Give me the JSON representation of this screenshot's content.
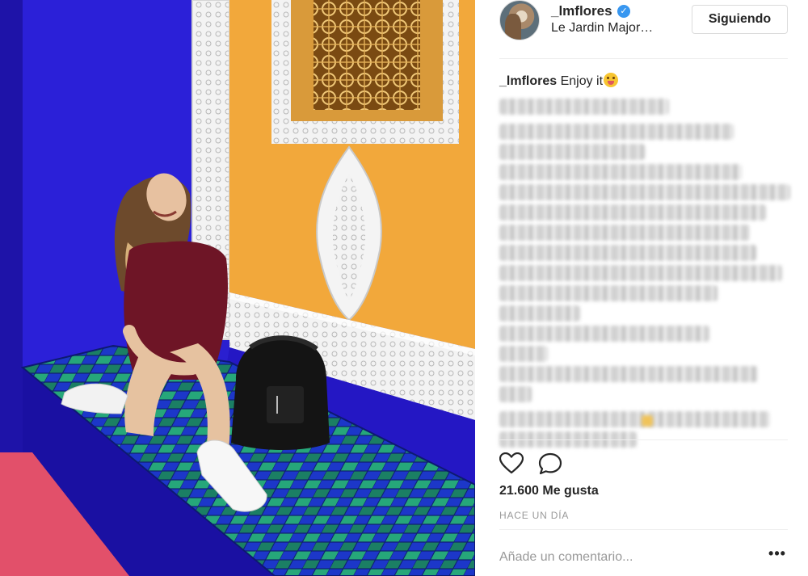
{
  "post": {
    "username": "_lmflores",
    "verified_icon": "verified-badge-icon",
    "location": "Le Jardin Major…",
    "follow_button": "Siguiendo",
    "caption": {
      "user": "_lmflores",
      "text": " Enjoy it"
    },
    "likes": "21.600 Me gusta",
    "timestamp": "HACE UN DÍA",
    "comment_placeholder": "Añade un comentario...",
    "more_options": "•••"
  },
  "icons": {
    "like": "heart-icon",
    "comment": "speech-bubble-icon",
    "options": "more-options-icon"
  },
  "colors": {
    "cobalt_blue": "#2a1fd0",
    "ochre_wall": "#f2a83b",
    "tile_green": "#1f9a6a",
    "verified_blue": "#3897f0",
    "muted_text": "#999999"
  }
}
